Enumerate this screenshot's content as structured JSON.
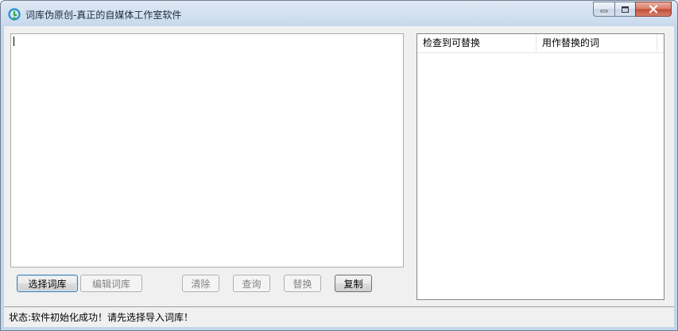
{
  "window": {
    "title": "词库伪原创-真正的自媒体工作室软件",
    "icon": "app-logo-icon"
  },
  "editor": {
    "text": ""
  },
  "result_list": {
    "columns": [
      "检查到可替换",
      "用作替换的词"
    ],
    "rows": []
  },
  "buttons": {
    "select_library": "选择词库",
    "edit_library": "编辑词库",
    "clear": "清除",
    "query": "查询",
    "replace": "替换",
    "copy": "复制"
  },
  "status": {
    "text": "状态:软件初始化成功！请先选择导入词库！"
  },
  "colors": {
    "title_bar": "#c4d6ec",
    "close_button": "#c24a34",
    "default_button_border": "#3c7fb1"
  }
}
